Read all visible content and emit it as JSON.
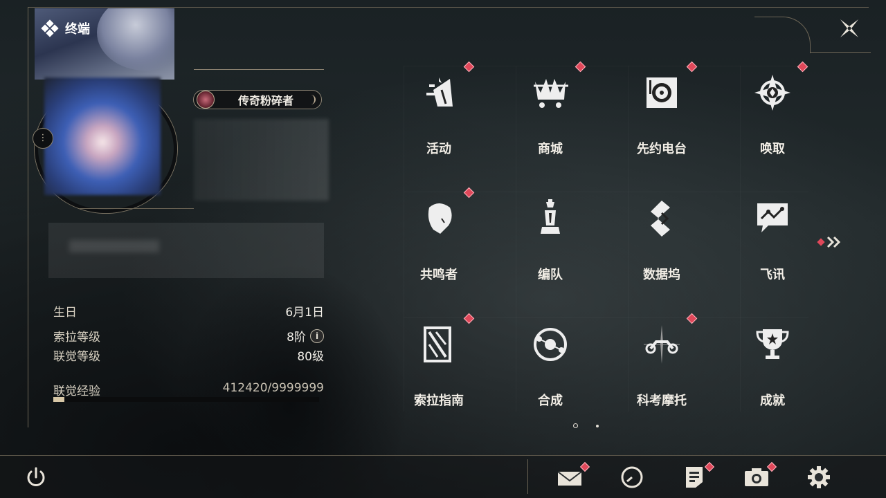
{
  "header": {
    "title": "终端",
    "close_icon": "close-x-icon"
  },
  "profile": {
    "badge_label": "传奇粉碎者",
    "birthday_label": "生日",
    "birthday_value": "6月1日",
    "sola_level_label": "索拉等级",
    "sola_level_value": "8阶",
    "sola_level_info": "i",
    "union_level_label": "联觉等级",
    "union_level_value": "80级",
    "union_exp_label": "联觉经验",
    "union_exp_value": "412420/9999999",
    "union_exp_fraction": 0.041
  },
  "menu": [
    {
      "label": "活动",
      "icon": "events-icon",
      "badge": true
    },
    {
      "label": "商城",
      "icon": "shop-crown-cart-icon",
      "badge": true
    },
    {
      "label": "先约电台",
      "icon": "radio-turntable-icon",
      "badge": true
    },
    {
      "label": "唤取",
      "icon": "convene-compass-icon",
      "badge": true
    },
    {
      "label": "共鸣者",
      "icon": "resonator-portrait-icon",
      "badge": true
    },
    {
      "label": "编队",
      "icon": "chess-team-icon",
      "badge": false
    },
    {
      "label": "数据坞",
      "icon": "data-dock-icon",
      "badge": false
    },
    {
      "label": "飞讯",
      "icon": "message-chat-icon",
      "badge": false
    },
    {
      "label": "索拉指南",
      "icon": "guidebook-icon",
      "badge": true
    },
    {
      "label": "合成",
      "icon": "synthesis-orbit-icon",
      "badge": false
    },
    {
      "label": "科考摩托",
      "icon": "motorcycle-icon",
      "badge": true
    },
    {
      "label": "成就",
      "icon": "trophy-icon",
      "badge": false
    }
  ],
  "pagination": {
    "current": 1,
    "total": 2
  },
  "bottom_bar": {
    "power": "power-icon",
    "mail": "mail-icon",
    "clock": "clock-icon",
    "notes": "notes-icon",
    "camera": "camera-icon",
    "settings": "settings-gear-icon"
  },
  "colors": {
    "accent_gold": "#8b8270",
    "badge_red": "#e0485a",
    "text": "#f2eee6"
  }
}
